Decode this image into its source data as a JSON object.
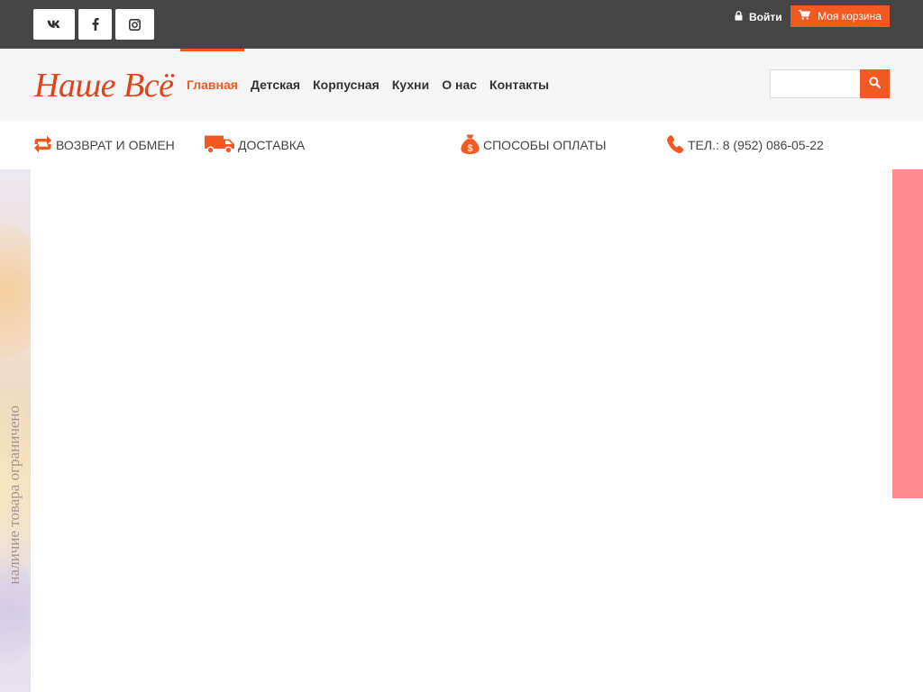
{
  "topbar": {
    "social": [
      {
        "name": "vk-icon"
      },
      {
        "name": "facebook-icon"
      },
      {
        "name": "instagram-icon"
      }
    ],
    "login_label": "Войти",
    "cart_label": "Моя корзина"
  },
  "header": {
    "logo": "Наше Всё",
    "nav": [
      {
        "label": "Главная",
        "active": true
      },
      {
        "label": "Детская",
        "active": false
      },
      {
        "label": "Корпусная",
        "active": false
      },
      {
        "label": "Кухни",
        "active": false
      },
      {
        "label": "О нас",
        "active": false
      },
      {
        "label": "Контакты",
        "active": false
      }
    ],
    "search": {
      "value": "",
      "placeholder": ""
    }
  },
  "infobar": {
    "return_label": "ВОЗВРАТ И ОБМЕН",
    "delivery_label": "ДОСТАВКА",
    "payment_label": "СПОСОБЫ ОПЛАТЫ",
    "phone_label": "ТЕЛ.: 8 (952) 086-05-22"
  },
  "banner": {
    "vertical_text": "наличие товара ограничено"
  },
  "colors": {
    "accent": "#f05a22",
    "topbar_bg": "#454545",
    "header_bg": "#f5f5f5",
    "banner_right_strip": "#ff8c8f"
  }
}
